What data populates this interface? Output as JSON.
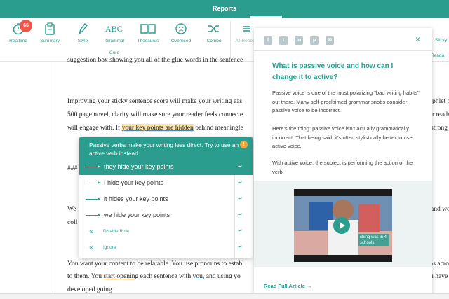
{
  "topbar": {
    "title": "Reports"
  },
  "toolbar": {
    "core": [
      {
        "label": "Realtime",
        "icon": "stopwatch-icon",
        "badge": "66"
      },
      {
        "label": "Summary",
        "icon": "clipboard-icon"
      },
      {
        "label": "Style",
        "icon": "pen-icon"
      },
      {
        "label": "Grammar",
        "icon": "abc-check-icon"
      },
      {
        "label": "Thesaurus",
        "icon": "book-icon"
      },
      {
        "label": "Overused",
        "icon": "face-icon"
      },
      {
        "label": "Combo",
        "icon": "shuffle-icon"
      }
    ],
    "core_group_label": "Core",
    "partial": [
      {
        "label": "All Repeats",
        "icon": "repeat-icon"
      },
      {
        "label": "Reada",
        "icon": "glasses-icon"
      },
      {
        "label": "Sticky",
        "icon": "sticky-icon"
      }
    ]
  },
  "document": {
    "line0": "suggestion box showing you all of the glue words in the sentence",
    "line1": "Improving your sticky sentence score will make your writing eas",
    "line1_right": "phlet o",
    "line2": "500 page novel, clarity will make sure your reader feels connecte",
    "line2_right": "r reade",
    "line3_pre": "will engage with. If ",
    "line3_hl": "your key points are hidden",
    "line3_post": " behind meaningle",
    "line3_right": "strong",
    "line4": "###",
    "line5a": "We",
    "line5a_right": "and wo",
    "line5b": "coll",
    "line6": "You want your content to be relatable. You use pronouns to establ",
    "line6_right": "as acro",
    "line7_pre": "to them. You ",
    "line7_u1": "start opening",
    "line7_mid": " each sentence with ",
    "line7_u2": "you",
    "line7_post": ", and using yo",
    "line7_right": "u have",
    "line8": "developed going."
  },
  "suggestion": {
    "message": "Passive verbs make your writing less direct. Try to use an active verb instead.",
    "info": "!",
    "options": [
      "they hide your key points",
      "I hide your key points",
      "it hides your key points",
      "we hide your key points"
    ],
    "disable_rule": "Disable Rule",
    "ignore": "Ignore",
    "return_glyph": "↵"
  },
  "sidebar": {
    "social": [
      "f",
      "t",
      "in",
      "p",
      "✉"
    ],
    "close": "×",
    "title": "What is passive voice and how can I change it to active?",
    "p1": "Passive voice is one of the most polarizing \"bad writing habits\" out there. Many self-proclaimed grammar snobs consider passive voice to be incorrect.",
    "p2": "Here's the thing: passive voice isn't actually grammatically incorrect. That being said, it's often stylistically better to use active voice.",
    "p3": "With active voice, the subject is performing the action of the verb.",
    "video_caption": "ching was in 4 schools.",
    "read_full": "Read Full Article →"
  }
}
